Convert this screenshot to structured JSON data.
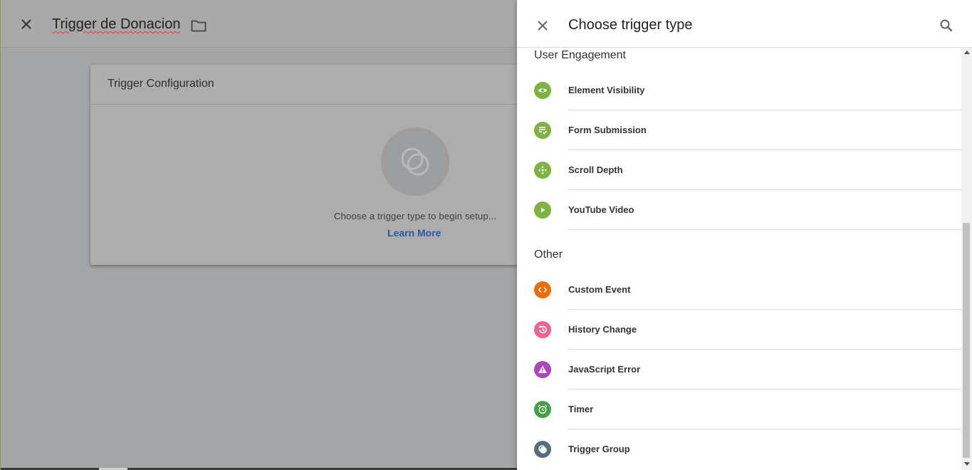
{
  "editor": {
    "title": "Trigger de Donacion",
    "card_title": "Trigger Configuration",
    "hint": "Choose a trigger type to begin setup...",
    "learn_more": "Learn More"
  },
  "panel": {
    "title": "Choose trigger type",
    "sections": [
      {
        "title": "User Engagement",
        "items": [
          {
            "label": "Element Visibility",
            "icon": "eye-icon",
            "color": "#7cb342"
          },
          {
            "label": "Form Submission",
            "icon": "form-check-icon",
            "color": "#7cb342"
          },
          {
            "label": "Scroll Depth",
            "icon": "move-arrows-icon",
            "color": "#7cb342"
          },
          {
            "label": "YouTube Video",
            "icon": "play-icon",
            "color": "#7cb342"
          }
        ]
      },
      {
        "title": "Other",
        "items": [
          {
            "label": "Custom Event",
            "icon": "code-brackets-icon",
            "color": "#ef6c00"
          },
          {
            "label": "History Change",
            "icon": "history-icon",
            "color": "#f06292"
          },
          {
            "label": "JavaScript Error",
            "icon": "warning-icon",
            "color": "#ab47bc"
          },
          {
            "label": "Timer",
            "icon": "alarm-clock-icon",
            "color": "#43a047"
          },
          {
            "label": "Trigger Group",
            "icon": "trigger-group-icon",
            "color": "#546e7a"
          }
        ]
      }
    ]
  }
}
